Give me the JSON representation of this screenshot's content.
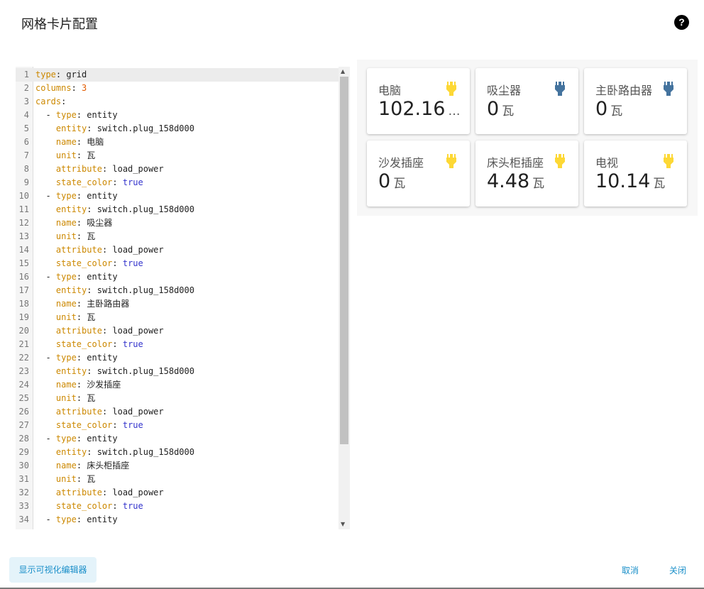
{
  "dialog": {
    "title": "网格卡片配置",
    "help_icon": "help-circle-icon"
  },
  "editor": {
    "lines": [
      [
        [
          "k",
          "type"
        ],
        [
          "t",
          ": grid"
        ]
      ],
      [
        [
          "k",
          "columns"
        ],
        [
          "t",
          ": "
        ],
        [
          "num",
          "3"
        ]
      ],
      [
        [
          "k",
          "cards"
        ],
        [
          "t",
          ":"
        ]
      ],
      [
        [
          "t",
          "  - "
        ],
        [
          "k",
          "type"
        ],
        [
          "t",
          ": entity"
        ]
      ],
      [
        [
          "t",
          "    "
        ],
        [
          "k",
          "entity"
        ],
        [
          "t",
          ": switch.plug_158d000"
        ]
      ],
      [
        [
          "t",
          "    "
        ],
        [
          "k",
          "name"
        ],
        [
          "t",
          ": 电脑"
        ]
      ],
      [
        [
          "t",
          "    "
        ],
        [
          "k",
          "unit"
        ],
        [
          "t",
          ": 瓦"
        ]
      ],
      [
        [
          "t",
          "    "
        ],
        [
          "k",
          "attribute"
        ],
        [
          "t",
          ": load_power"
        ]
      ],
      [
        [
          "t",
          "    "
        ],
        [
          "k",
          "state_color"
        ],
        [
          "t",
          ": "
        ],
        [
          "bool",
          "true"
        ]
      ],
      [
        [
          "t",
          "  - "
        ],
        [
          "k",
          "type"
        ],
        [
          "t",
          ": entity"
        ]
      ],
      [
        [
          "t",
          "    "
        ],
        [
          "k",
          "entity"
        ],
        [
          "t",
          ": switch.plug_158d000"
        ]
      ],
      [
        [
          "t",
          "    "
        ],
        [
          "k",
          "name"
        ],
        [
          "t",
          ": 吸尘器"
        ]
      ],
      [
        [
          "t",
          "    "
        ],
        [
          "k",
          "unit"
        ],
        [
          "t",
          ": 瓦"
        ]
      ],
      [
        [
          "t",
          "    "
        ],
        [
          "k",
          "attribute"
        ],
        [
          "t",
          ": load_power"
        ]
      ],
      [
        [
          "t",
          "    "
        ],
        [
          "k",
          "state_color"
        ],
        [
          "t",
          ": "
        ],
        [
          "bool",
          "true"
        ]
      ],
      [
        [
          "t",
          "  - "
        ],
        [
          "k",
          "type"
        ],
        [
          "t",
          ": entity"
        ]
      ],
      [
        [
          "t",
          "    "
        ],
        [
          "k",
          "entity"
        ],
        [
          "t",
          ": switch.plug_158d000"
        ]
      ],
      [
        [
          "t",
          "    "
        ],
        [
          "k",
          "name"
        ],
        [
          "t",
          ": 主卧路由器"
        ]
      ],
      [
        [
          "t",
          "    "
        ],
        [
          "k",
          "unit"
        ],
        [
          "t",
          ": 瓦"
        ]
      ],
      [
        [
          "t",
          "    "
        ],
        [
          "k",
          "attribute"
        ],
        [
          "t",
          ": load_power"
        ]
      ],
      [
        [
          "t",
          "    "
        ],
        [
          "k",
          "state_color"
        ],
        [
          "t",
          ": "
        ],
        [
          "bool",
          "true"
        ]
      ],
      [
        [
          "t",
          "  - "
        ],
        [
          "k",
          "type"
        ],
        [
          "t",
          ": entity"
        ]
      ],
      [
        [
          "t",
          "    "
        ],
        [
          "k",
          "entity"
        ],
        [
          "t",
          ": switch.plug_158d000"
        ]
      ],
      [
        [
          "t",
          "    "
        ],
        [
          "k",
          "name"
        ],
        [
          "t",
          ": 沙发插座"
        ]
      ],
      [
        [
          "t",
          "    "
        ],
        [
          "k",
          "unit"
        ],
        [
          "t",
          ": 瓦"
        ]
      ],
      [
        [
          "t",
          "    "
        ],
        [
          "k",
          "attribute"
        ],
        [
          "t",
          ": load_power"
        ]
      ],
      [
        [
          "t",
          "    "
        ],
        [
          "k",
          "state_color"
        ],
        [
          "t",
          ": "
        ],
        [
          "bool",
          "true"
        ]
      ],
      [
        [
          "t",
          "  - "
        ],
        [
          "k",
          "type"
        ],
        [
          "t",
          ": entity"
        ]
      ],
      [
        [
          "t",
          "    "
        ],
        [
          "k",
          "entity"
        ],
        [
          "t",
          ": switch.plug_158d000"
        ]
      ],
      [
        [
          "t",
          "    "
        ],
        [
          "k",
          "name"
        ],
        [
          "t",
          ": 床头柜插座"
        ]
      ],
      [
        [
          "t",
          "    "
        ],
        [
          "k",
          "unit"
        ],
        [
          "t",
          ": 瓦"
        ]
      ],
      [
        [
          "t",
          "    "
        ],
        [
          "k",
          "attribute"
        ],
        [
          "t",
          ": load_power"
        ]
      ],
      [
        [
          "t",
          "    "
        ],
        [
          "k",
          "state_color"
        ],
        [
          "t",
          ": "
        ],
        [
          "bool",
          "true"
        ]
      ],
      [
        [
          "t",
          "  - "
        ],
        [
          "k",
          "type"
        ],
        [
          "t",
          ": entity"
        ]
      ]
    ]
  },
  "preview": {
    "cards": [
      {
        "name": "电脑",
        "value": "102.16",
        "unit": "…",
        "icon": "power-plug-icon",
        "icon_color": "#fdd835"
      },
      {
        "name": "吸尘器",
        "value": "0",
        "unit": "瓦",
        "icon": "power-plug-icon",
        "icon_color": "#44739e"
      },
      {
        "name": "主卧路由器",
        "value": "0",
        "unit": "瓦",
        "icon": "power-plug-icon",
        "icon_color": "#44739e"
      },
      {
        "name": "沙发插座",
        "value": "0",
        "unit": "瓦",
        "icon": "power-plug-icon",
        "icon_color": "#fdd835"
      },
      {
        "name": "床头柜插座",
        "value": "4.48",
        "unit": "瓦",
        "icon": "power-plug-icon",
        "icon_color": "#fdd835"
      },
      {
        "name": "电视",
        "value": "10.14",
        "unit": "瓦",
        "icon": "power-plug-icon",
        "icon_color": "#fdd835"
      }
    ]
  },
  "footer": {
    "show_visual_editor": "显示可视化编辑器",
    "cancel": "取消",
    "close": "关闭",
    "accent_color": "#1a8fc9"
  }
}
